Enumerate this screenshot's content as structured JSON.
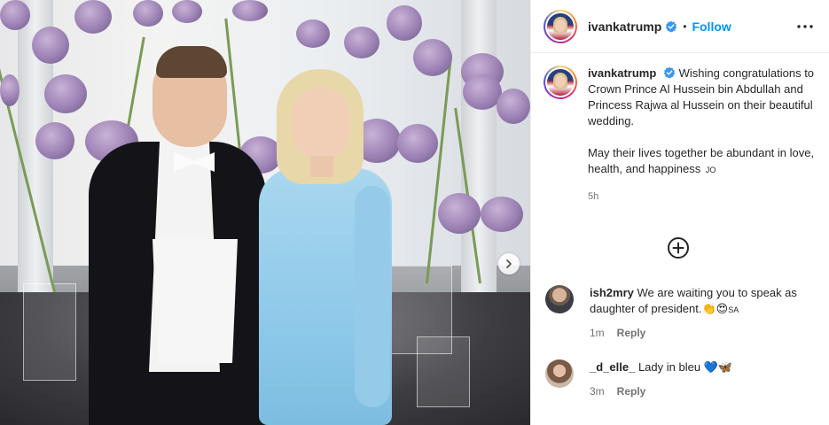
{
  "post": {
    "username": "ivankatrump",
    "follow_label": "Follow",
    "dot": "•",
    "more_icon": "more-horizontal-icon"
  },
  "caption": {
    "username": "ivankatrump",
    "line1": "Wishing congratulations to Crown Prince Al Hussein bin Abdullah and Princess Rajwa al Hussein on their beautiful wedding.",
    "line2": "May their lives together be abundant in love, health, and happiness",
    "flag": "JO",
    "time": "5h"
  },
  "comments": [
    {
      "username": "ish2mry",
      "text": "We are waiting you to speak as daughter of president.",
      "emoji": "👏😍",
      "flag": "SA",
      "time": "1m",
      "reply_label": "Reply"
    },
    {
      "username": "_d_elle_",
      "text": "Lady in bleu",
      "emoji": "💙🦋",
      "time": "3m",
      "reply_label": "Reply"
    }
  ],
  "colors": {
    "follow": "#0095f6",
    "verified": "#3897f0",
    "muted": "#737373"
  }
}
